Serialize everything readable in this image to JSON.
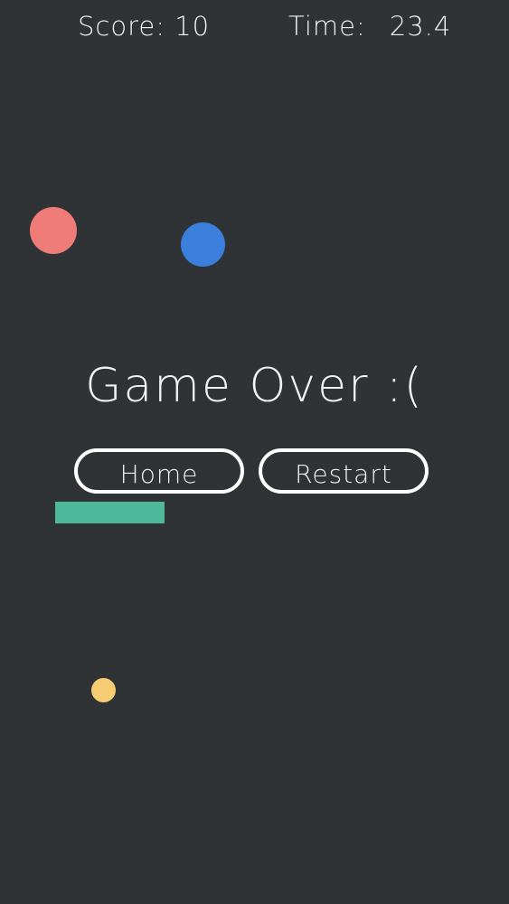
{
  "hud": {
    "score_label": "Score: 10",
    "time_label": "Time:",
    "time_value": "23.4"
  },
  "game_over": {
    "title": "Game Over :(",
    "home_label": "Home",
    "restart_label": "Restart"
  },
  "objects": {
    "ball_red": {
      "color": "#ef7c78"
    },
    "ball_blue": {
      "color": "#3b7fdc"
    },
    "ball_yellow": {
      "color": "#f6cd72"
    },
    "paddle": {
      "color": "#4fb89a"
    }
  }
}
